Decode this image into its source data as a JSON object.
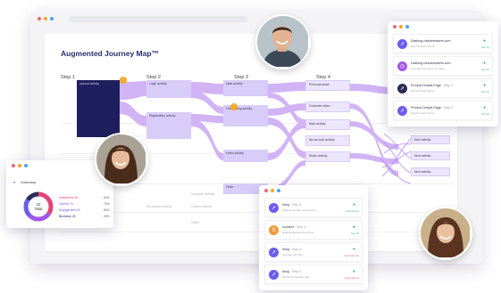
{
  "page": {
    "title": "Augmented Journey Map™",
    "steps": [
      "Step 1",
      "Step 2",
      "Step 3",
      "Step 4"
    ]
  },
  "journey": {
    "step1": {
      "upload": "Upload activity"
    },
    "step2": {
      "login": "Login activity",
      "registration": "Registration activity",
      "grey": "No account activity"
    },
    "step3": {
      "main": "Main activity",
      "onboarding": "Onboarding activity",
      "video": "Video activity",
      "other": "Other",
      "grey1": "Customer activity",
      "grey2": "Content activity",
      "grey3": "Video"
    },
    "step4": {
      "personal": "Personal detail",
      "customer_video": "Customer video",
      "main": "Main activity",
      "account": "My account activity",
      "share": "Share activity"
    },
    "step5": {
      "a": "Next activity",
      "b": "Next activity",
      "c": "Next activity"
    }
  },
  "top_card": {
    "items": [
      {
        "title": "Dashing.cleanbreakers.com",
        "sub": "Net Promoter Score",
        "tag": "Top 10",
        "icon_color": "#6b5cf0",
        "icon": "rocket-icon"
      },
      {
        "title": "Dashing.cleanbreakers.com",
        "sub": "Average time spent on page",
        "tag": "Top 10",
        "icon_color": "#a357e8",
        "icon": "clock-icon"
      },
      {
        "title": "Product Details Page",
        "step": "Step 3",
        "sub": "Net Promoter Score",
        "tag": "Top 10",
        "icon_color": "#2c2c5a",
        "icon": "rocket-icon"
      },
      {
        "title": "Product Details Page",
        "step": "Step 5",
        "sub": "Net Promoter Score",
        "tag": "Top 10",
        "icon_color": "#6b5cf0",
        "icon": "rocket-icon"
      }
    ]
  },
  "bottom_card": {
    "items": [
      {
        "title": "/blog",
        "step": "Step 4",
        "sub": "Highest number of sessions",
        "tag": "Conversion",
        "icon_color": "#6b5cf0",
        "icon": "rocket-icon",
        "tag_color": "#3cb878"
      },
      {
        "title": "/content",
        "step": "Step 4",
        "sub": "Highest abandonment rate",
        "tag": "Top 10",
        "icon_color": "#f39a3c",
        "icon": "s-icon",
        "tag_color": "#3cb878"
      },
      {
        "title": "/blog",
        "step": "Step 4",
        "sub": "Average exit rate",
        "tag": "Low bounce",
        "icon_color": "#6b5cf0",
        "icon": "rocket-icon",
        "tag_color": "#f05a6a"
      },
      {
        "title": "/blog",
        "step": "Step 5",
        "sub": "Off-funnel session rate",
        "tag": "Low bounce",
        "icon_color": "#6b5cf0",
        "icon": "rocket-icon",
        "tag_color": "#f05a6a"
      }
    ]
  },
  "summary": {
    "title": "Summary",
    "donut_value": "10",
    "donut_label": "Total",
    "legend": [
      {
        "label": "Awareness 80",
        "value": "80%",
        "color": "#e2457a"
      },
      {
        "label": "Interest 70",
        "value": "70%",
        "color": "#a357e8"
      },
      {
        "label": "Engagement 50",
        "value": "50%",
        "color": "#6b5cf0"
      },
      {
        "label": "Business 25",
        "value": "25%",
        "color": "#2c2c5a"
      }
    ],
    "segments": [
      0.34,
      0.28,
      0.22,
      0.16
    ]
  },
  "colors": {
    "flow": "#c9a6f5",
    "node": "#d8cdf8",
    "dark": "#1f1f5e",
    "accent": "#f5a623"
  }
}
